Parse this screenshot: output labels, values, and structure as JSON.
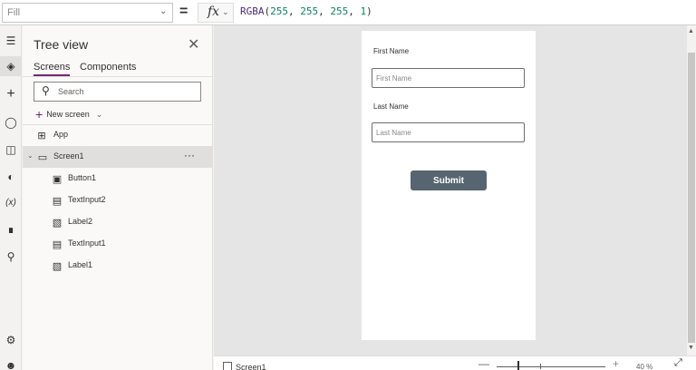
{
  "formula_bar": {
    "property": "Fill",
    "fx": "fx",
    "formula_fn": "RGBA",
    "formula_open": "(",
    "r": "255",
    "g": "255",
    "b": "255",
    "a": "1",
    "sep": ", ",
    "formula_close": ")"
  },
  "rail": {
    "icons": [
      "hamburger-icon",
      "layers-icon",
      "plus-icon",
      "database-icon",
      "media-icon",
      "theme-icon",
      "variables-icon",
      "tools-icon",
      "search-icon",
      "settings-icon",
      "account-icon"
    ],
    "variables_label": "(x)"
  },
  "tree": {
    "title": "Tree view",
    "tabs": [
      "Screens",
      "Components"
    ],
    "search_placeholder": "Search",
    "new_screen": "New screen",
    "nodes": [
      {
        "label": "App",
        "icon": "app-icon"
      },
      {
        "label": "Screen1",
        "icon": "screen-icon",
        "more": "···"
      },
      {
        "label": "Button1",
        "icon": "button-icon"
      },
      {
        "label": "TextInput2",
        "icon": "textinput-icon"
      },
      {
        "label": "Label2",
        "icon": "label-icon"
      },
      {
        "label": "TextInput1",
        "icon": "textinput-icon"
      },
      {
        "label": "Label1",
        "icon": "label-icon"
      }
    ]
  },
  "form": {
    "first_name_label": "First Name",
    "first_name_placeholder": "First Name",
    "last_name_label": "Last Name",
    "last_name_placeholder": "Last Name",
    "submit": "Submit"
  },
  "status": {
    "screen": "Screen1",
    "zoom": "40  %"
  },
  "colors": {
    "accent": "#742774",
    "button": "#56656f",
    "canvas": "#e5e5e5"
  }
}
